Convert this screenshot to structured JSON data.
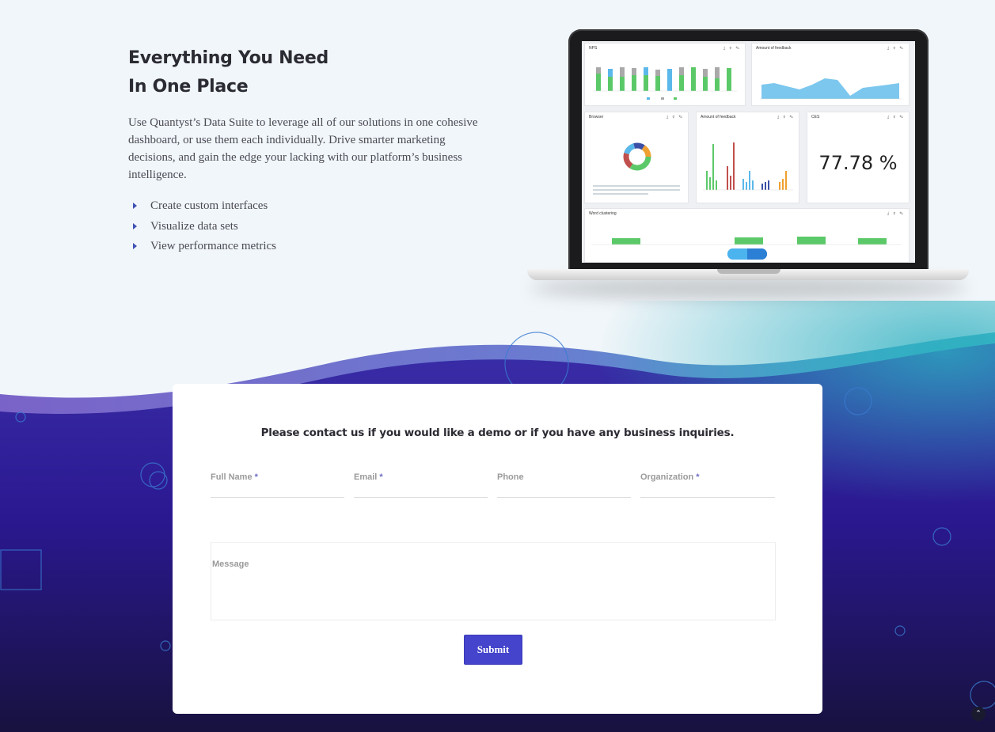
{
  "hero": {
    "title_line1": "Everything You Need",
    "title_line2": "In One Place",
    "description": "Use Quantyst’s Data Suite to leverage all of our solutions in one cohesive dashboard, or use them each individually. Drive smarter marketing decisions, and gain the edge your lacking with our platform’s business intelligence.",
    "bullets": [
      "Create custom interfaces",
      "Visualize data sets",
      "View performance metrics"
    ],
    "bullet_color": "#3f51b5"
  },
  "dashboard": {
    "panels": [
      {
        "title": "NPS",
        "tools": "⤓ ⚲ ✎"
      },
      {
        "title": "Amount of feedback",
        "tools": "⤓ ⚲ ✎"
      },
      {
        "title": "Browser",
        "tools": "⤓ ⚲ ✎"
      },
      {
        "title": "Amount of feedback",
        "tools": "⤓ ⚲ ✎"
      },
      {
        "title": "CES",
        "tools": "⤓ ⚲ ✎"
      },
      {
        "title": "Word clustering",
        "tools": "⤓ ⚲ ✎"
      }
    ],
    "ces_value": "77.78 %",
    "accent_green": "#5cc969",
    "accent_blue": "#5bb8ea",
    "accent_gray": "#a9a9a9",
    "accent_red": "#c0504d",
    "accent_orange": "#f0a030"
  },
  "contact": {
    "heading": "Please contact us if you would like a demo or if you have any business inquiries.",
    "fields": [
      {
        "label": "Full Name",
        "required": "*"
      },
      {
        "label": "Email",
        "required": "*"
      },
      {
        "label": "Phone",
        "required": ""
      },
      {
        "label": "Organization",
        "required": "*"
      }
    ],
    "message_label": "Message",
    "submit_label": "Submit",
    "button_color": "#4444cc"
  },
  "scroll_top_icon": "⌃"
}
